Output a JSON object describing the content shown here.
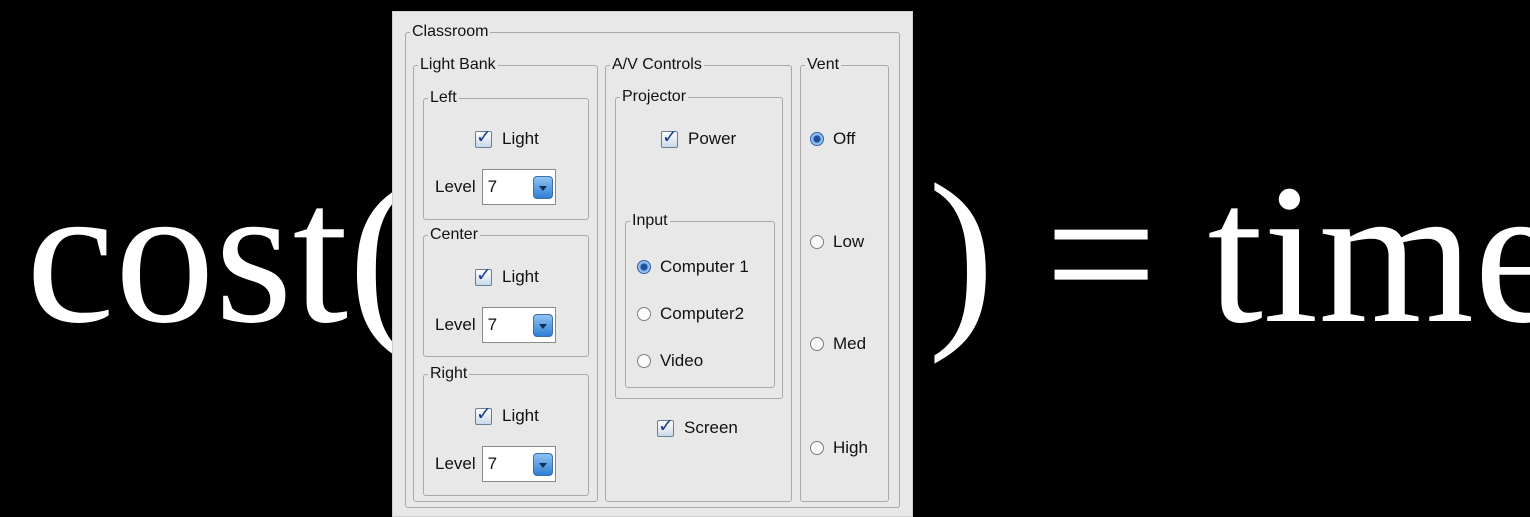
{
  "equation": {
    "left": "cost(",
    "right": ") = time"
  },
  "panel": {
    "title": "Classroom",
    "light_bank": {
      "title": "Light Bank",
      "groups": [
        {
          "title": "Left",
          "checkbox": "Light",
          "checked": true,
          "level_label": "Level",
          "level_value": "7"
        },
        {
          "title": "Center",
          "checkbox": "Light",
          "checked": true,
          "level_label": "Level",
          "level_value": "7"
        },
        {
          "title": "Right",
          "checkbox": "Light",
          "checked": true,
          "level_label": "Level",
          "level_value": "7"
        }
      ]
    },
    "av_controls": {
      "title": "A/V Controls",
      "projector": {
        "title": "Projector",
        "power_label": "Power",
        "power_checked": true,
        "input": {
          "title": "Input",
          "options": [
            "Computer 1",
            "Computer2",
            "Video"
          ],
          "selected": "Computer 1"
        }
      },
      "screen_label": "Screen",
      "screen_checked": true
    },
    "vent": {
      "title": "Vent",
      "options": [
        "Off",
        "Low",
        "Med",
        "High"
      ],
      "selected": "Off"
    }
  }
}
